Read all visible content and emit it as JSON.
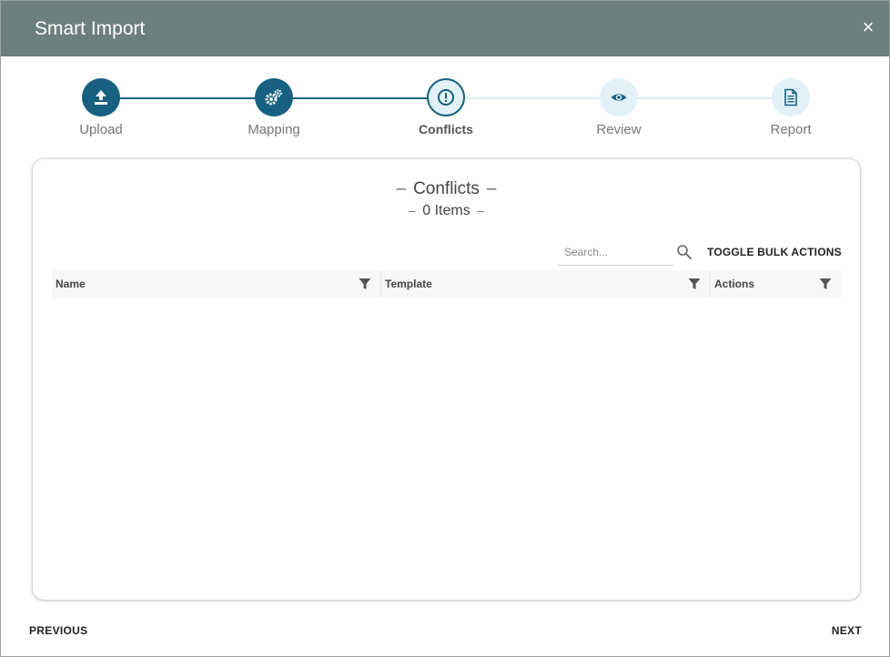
{
  "dialog": {
    "title": "Smart Import",
    "close_glyph": "×"
  },
  "stepper": {
    "steps": [
      {
        "label": "Upload",
        "icon": "upload-icon",
        "state": "done"
      },
      {
        "label": "Mapping",
        "icon": "gears-icon",
        "state": "done"
      },
      {
        "label": "Conflicts",
        "icon": "exclamation-circle-icon",
        "state": "active"
      },
      {
        "label": "Review",
        "icon": "eye-icon",
        "state": "todo"
      },
      {
        "label": "Report",
        "icon": "document-icon",
        "state": "todo"
      }
    ]
  },
  "card": {
    "title": "Conflicts",
    "subtitle": "0 Items",
    "dash": "–",
    "search": {
      "placeholder": "Search...",
      "value": ""
    },
    "toggle_bulk_label": "TOGGLE BULK ACTIONS",
    "columns": [
      {
        "label": "Name"
      },
      {
        "label": "Template"
      },
      {
        "label": "Actions"
      }
    ]
  },
  "footer": {
    "previous_label": "PREVIOUS",
    "next_label": "NEXT"
  },
  "colors": {
    "header": "#6b7f7c",
    "primary": "#17607f",
    "step_light": "#e2f1f8"
  }
}
